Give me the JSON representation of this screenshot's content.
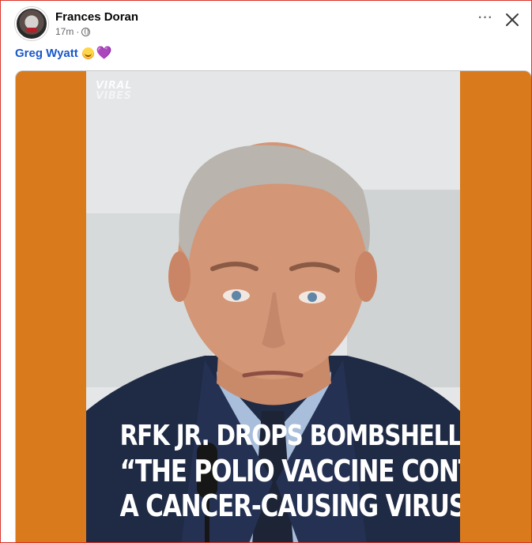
{
  "post": {
    "author": "Frances Doran",
    "time": "17m",
    "separator": "·",
    "audience_icon": "globe-icon",
    "mention": "Greg Wyatt",
    "emojis": [
      "face-with-hearts-emoji",
      "purple-heart-emoji"
    ],
    "heart_char": "💜"
  },
  "actions": {
    "more_label": "···",
    "close_icon": "close-icon"
  },
  "media": {
    "background": "#d97a1c",
    "watermark_line1": "VIRAL",
    "watermark_line2": "VIBES",
    "headline": [
      "RFK JR. DROPS BOMBSHELL:",
      "“THE POLIO VACCINE CONTAINED",
      "A CANCER-CAUSING VIRUS”"
    ]
  }
}
